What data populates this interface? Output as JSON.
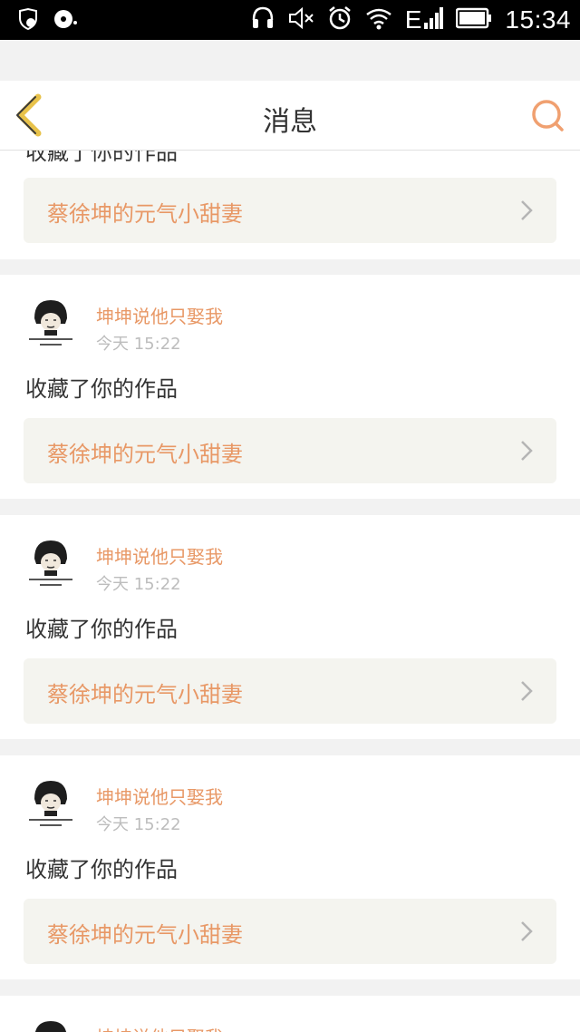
{
  "status_bar": {
    "icons_left": [
      "shield-check-icon",
      "disc-icon"
    ],
    "icons_right": [
      "headset-icon",
      "mute-icon",
      "alarm-icon",
      "wifi-icon",
      "signal-icon",
      "battery-icon"
    ],
    "network": "E",
    "time": "15:34"
  },
  "header": {
    "back_icon": "chevron-left-icon",
    "title": "消息",
    "search_icon": "search-icon",
    "accent_color": "#f0a070"
  },
  "partial_top": {
    "action_text": "收藏了你的作品",
    "work_title": "蔡徐坤的元气小甜妻"
  },
  "messages": [
    {
      "avatar_icon": "meme-face-avatar",
      "username": "坤坤说他只娶我",
      "timestamp": "今天 15:22",
      "action_text": "收藏了你的作品",
      "work_title": "蔡徐坤的元气小甜妻"
    },
    {
      "avatar_icon": "meme-face-avatar",
      "username": "坤坤说他只娶我",
      "timestamp": "今天 15:22",
      "action_text": "收藏了你的作品",
      "work_title": "蔡徐坤的元气小甜妻"
    },
    {
      "avatar_icon": "meme-face-avatar",
      "username": "坤坤说他只娶我",
      "timestamp": "今天 15:22",
      "action_text": "收藏了你的作品",
      "work_title": "蔡徐坤的元气小甜妻"
    }
  ],
  "partial_bottom": {
    "username": "坤坤说他只娶我"
  },
  "colors": {
    "accent": "#e89866",
    "background": "#f2f2f2",
    "card": "#ffffff",
    "link_bg": "#f4f4ef",
    "back_icon": "#e8c24a"
  }
}
